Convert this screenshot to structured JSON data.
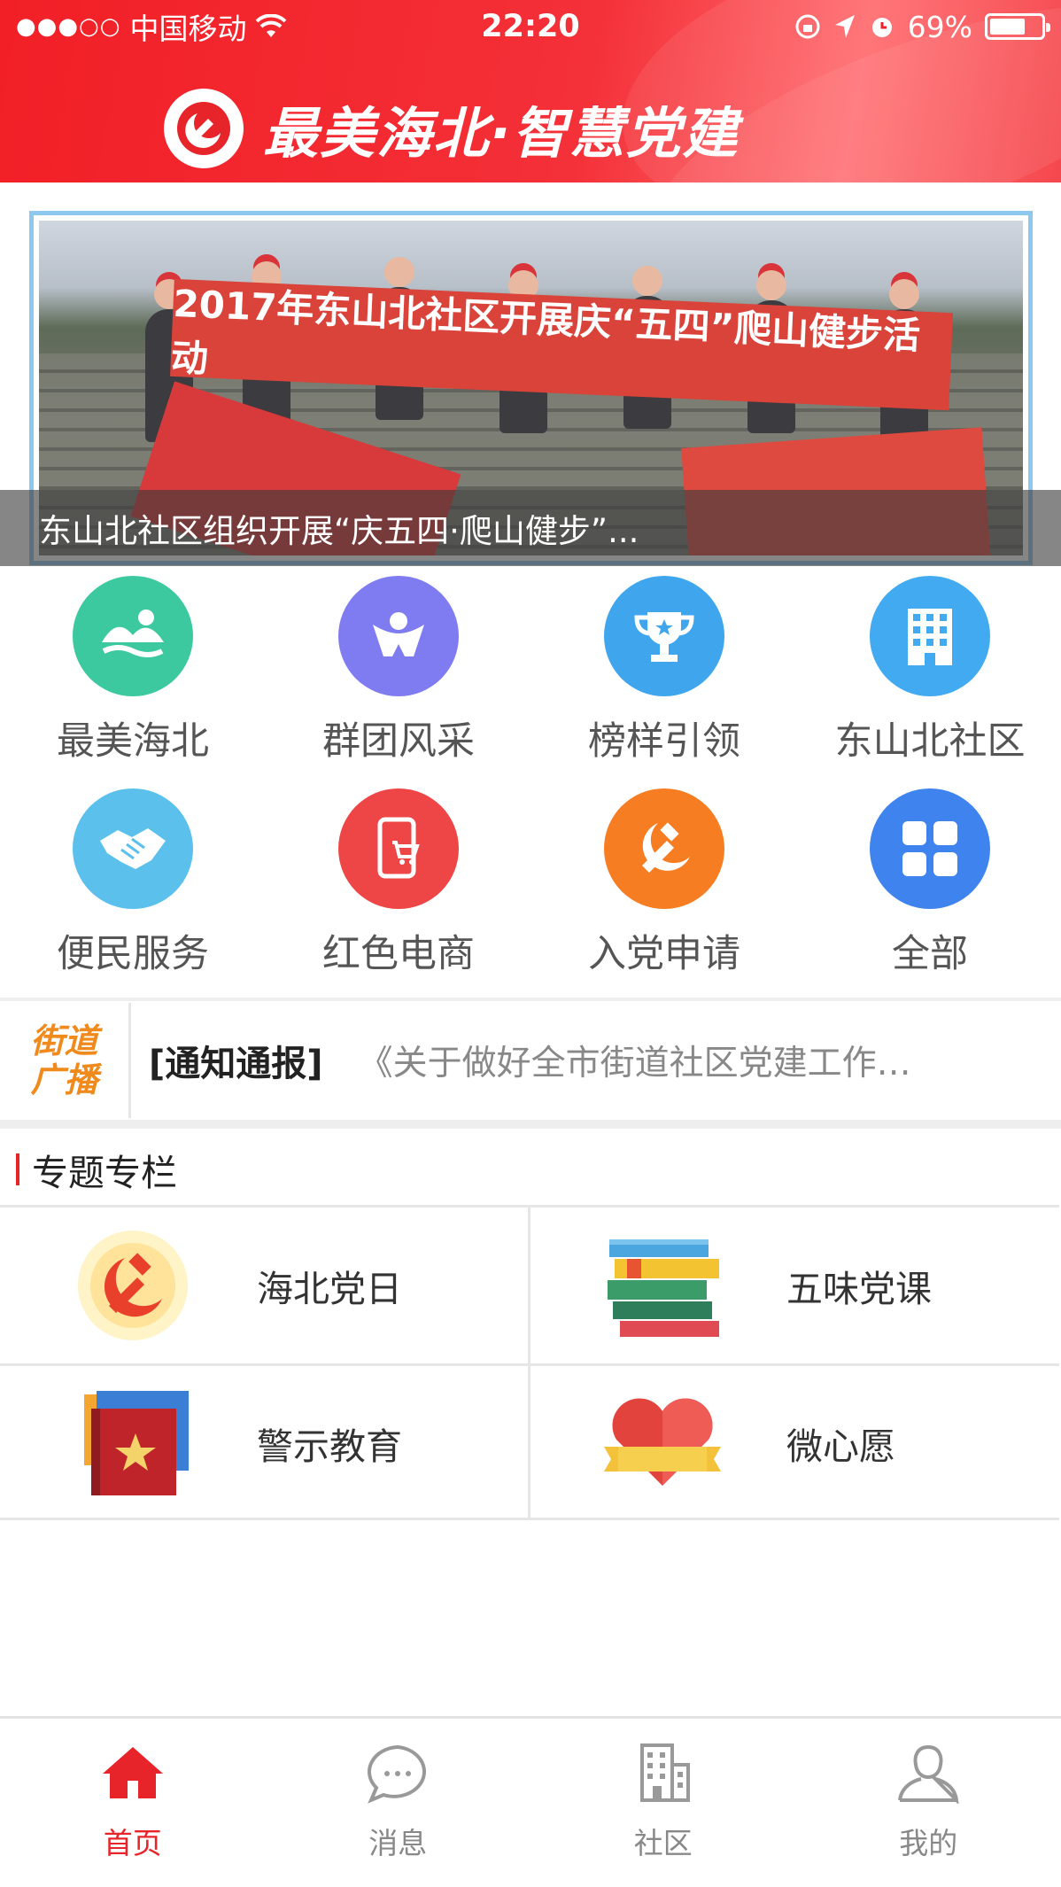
{
  "status_bar": {
    "carrier": "中国移动",
    "time": "22:20",
    "battery_text": "69%",
    "battery_level": 0.69
  },
  "header": {
    "title": "最美海北·智慧党建"
  },
  "banner": {
    "caption": "东山北社区组织开展“庆五四·爬山健步”...",
    "flag_text": "2017年东山北社区开展庆“五四”爬山健步活动"
  },
  "grid": [
    {
      "label": "最美海北",
      "icon": "landscape-icon",
      "color": "#3cc9a0"
    },
    {
      "label": "群团风采",
      "icon": "people-icon",
      "color": "#7e7cf0"
    },
    {
      "label": "榜样引领",
      "icon": "trophy-icon",
      "color": "#3fa6ee"
    },
    {
      "label": "东山北社区",
      "icon": "building-icon",
      "color": "#42aaf0"
    },
    {
      "label": "便民服务",
      "icon": "handshake-icon",
      "color": "#5bc0ec"
    },
    {
      "label": "红色电商",
      "icon": "phone-cart-icon",
      "color": "#ee4646"
    },
    {
      "label": "入党申请",
      "icon": "party-emblem-icon",
      "color": "#f67d22"
    },
    {
      "label": "全部",
      "icon": "grid-icon",
      "color": "#3f84ee"
    }
  ],
  "notice": {
    "logo_line1": "街道",
    "logo_line2": "广播",
    "tag": "[通知通报]",
    "text": "《关于做好全市街道社区党建工作…"
  },
  "section": {
    "title": "专题专栏",
    "cards": [
      {
        "label": "海北党日",
        "icon": "party-emblem-sun-icon"
      },
      {
        "label": "五味党课",
        "icon": "books-icon"
      },
      {
        "label": "警示教育",
        "icon": "red-book-star-icon"
      },
      {
        "label": "微心愿",
        "icon": "heart-ribbon-icon"
      }
    ]
  },
  "tabbar": [
    {
      "label": "首页",
      "icon": "home-icon",
      "active": true
    },
    {
      "label": "消息",
      "icon": "chat-bubble-icon",
      "active": false
    },
    {
      "label": "社区",
      "icon": "building-outline-icon",
      "active": false
    },
    {
      "label": "我的",
      "icon": "user-icon",
      "active": false
    }
  ]
}
